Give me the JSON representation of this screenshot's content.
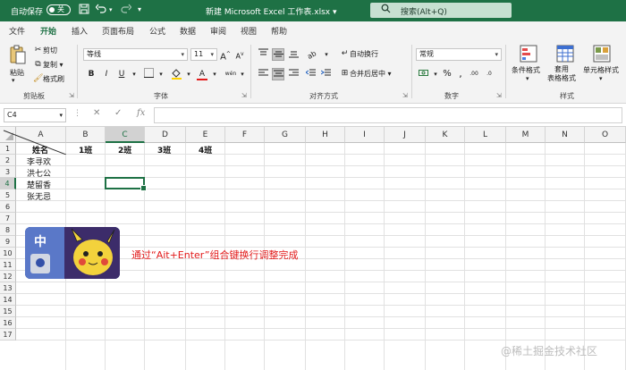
{
  "titlebar": {
    "autosave_label": "自动保存",
    "autosave_state": "关",
    "title": "新建 Microsoft Excel 工作表.xlsx",
    "title_caret": "▾",
    "search_label": "搜索(Alt+Q)"
  },
  "tabs": [
    {
      "label": "文件"
    },
    {
      "label": "开始"
    },
    {
      "label": "插入"
    },
    {
      "label": "页面布局"
    },
    {
      "label": "公式"
    },
    {
      "label": "数据"
    },
    {
      "label": "审阅"
    },
    {
      "label": "视图"
    },
    {
      "label": "帮助"
    }
  ],
  "ribbon": {
    "clipboard": {
      "group_label": "剪贴板",
      "paste": "粘贴",
      "cut": "剪切",
      "copy": "复制",
      "format_painter": "格式刷"
    },
    "font": {
      "group_label": "字体",
      "font_name": "等线",
      "font_size": "11",
      "grow": "A",
      "shrink": "A",
      "bold": "B",
      "italic": "I",
      "underline": "U",
      "font_color_letter": "A",
      "phonetic": "wén"
    },
    "alignment": {
      "group_label": "对齐方式",
      "wrap_text": "自动换行",
      "merge_center": "合并后居中"
    },
    "number": {
      "group_label": "数字",
      "format": "常规",
      "increase_decimal": ".00",
      "decrease_decimal": ".0"
    },
    "styles": {
      "group_label": "样式",
      "conditional": "条件格式",
      "table_format": "套用\n表格格式",
      "cell_styles": "单元格样式"
    }
  },
  "formula_bar": {
    "name_box": "C4",
    "cancel": "✕",
    "enter": "✓",
    "fx": "fx",
    "value": ""
  },
  "sheet": {
    "columns": [
      "A",
      "B",
      "C",
      "D",
      "E",
      "F",
      "G",
      "H",
      "I",
      "J",
      "K",
      "L",
      "M",
      "N",
      "O"
    ],
    "rows": [
      "1",
      "2",
      "3",
      "4",
      "5",
      "6",
      "7",
      "8",
      "9",
      "10",
      "11",
      "12",
      "13",
      "14",
      "15",
      "16",
      "17"
    ],
    "selected_col": "C",
    "selected_row": "4",
    "cells": {
      "A1": "姓名",
      "B1": "1班",
      "C1": "2班",
      "D1": "3班",
      "E1": "4班",
      "A2": "李寻欢",
      "A3": "洪七公",
      "A4": "楚留香",
      "A5": "张无忌"
    }
  },
  "sticker_text": "中",
  "annotation": "通过“Ait+Enter”组合键换行调整完成",
  "watermark": "@稀土掘金技术社区",
  "colors": {
    "excel_green": "#1e7145",
    "annotation_red": "#e21b1b"
  }
}
